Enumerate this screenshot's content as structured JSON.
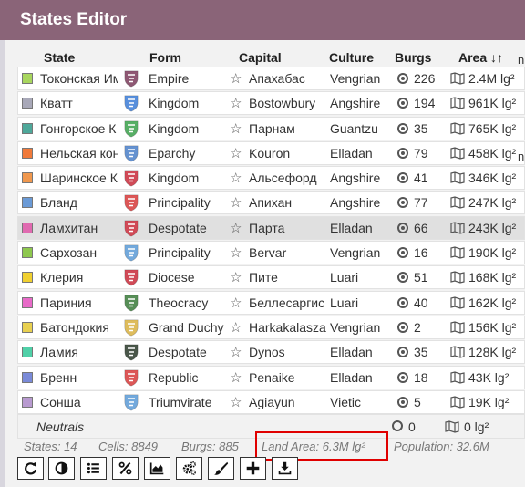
{
  "window": {
    "title": "States Editor"
  },
  "columns": {
    "state": "State",
    "form": "Form",
    "capital": "Capital",
    "culture": "Culture",
    "burgs": "Burgs",
    "area": "Area ↓↑"
  },
  "states": [
    {
      "color": "#a8d65e",
      "name": "Токонская Им",
      "form": "Empire",
      "capital": "Апахабас",
      "culture": "Vengrian",
      "burgs": "226",
      "area": "2.4M lg²",
      "shield_color": "#7a3b5b",
      "highlighted": false
    },
    {
      "color": "#a8a8b8",
      "name": "Кватт",
      "form": "Kingdom",
      "capital": "Bostowbury",
      "culture": "Angshire",
      "burgs": "194",
      "area": "961K lg²",
      "shield_color": "#3b7bd6",
      "highlighted": false
    },
    {
      "color": "#4ea89a",
      "name": "Гонгорское К",
      "form": "Kingdom",
      "capital": "Парнам",
      "culture": "Guantzu",
      "burgs": "35",
      "area": "765K lg²",
      "shield_color": "#3aa04a",
      "highlighted": false
    },
    {
      "color": "#f07a3a",
      "name": "Нельская кон",
      "form": "Eparchy",
      "capital": "Kouron",
      "culture": "Elladan",
      "burgs": "79",
      "area": "458K lg²",
      "shield_color": "#4a7fc8",
      "highlighted": false
    },
    {
      "color": "#f0984e",
      "name": "Шаринское К",
      "form": "Kingdom",
      "capital": "Альсефорд",
      "culture": "Angshire",
      "burgs": "41",
      "area": "346K lg²",
      "shield_color": "#c82a3a",
      "highlighted": false
    },
    {
      "color": "#6a9ad6",
      "name": "Бланд",
      "form": "Principality",
      "capital": "Апихан",
      "culture": "Angshire",
      "burgs": "77",
      "area": "247K lg²",
      "shield_color": "#d63a3a",
      "highlighted": false
    },
    {
      "color": "#e06ab0",
      "name": "Ламхитан",
      "form": "Despotate",
      "capital": "Парта",
      "culture": "Elladan",
      "burgs": "66",
      "area": "243K lg²",
      "shield_color": "#c82a3a",
      "highlighted": true
    },
    {
      "color": "#8ec84e",
      "name": "Сархозан",
      "form": "Principality",
      "capital": "Bervar",
      "culture": "Vengrian",
      "burgs": "16",
      "area": "190K lg²",
      "shield_color": "#5a9ad6",
      "highlighted": false
    },
    {
      "color": "#f0d030",
      "name": "Клерия",
      "form": "Diocese",
      "capital": "Пите",
      "culture": "Luari",
      "burgs": "51",
      "area": "168K lg²",
      "shield_color": "#c82a3a",
      "highlighted": false
    },
    {
      "color": "#e86ac8",
      "name": "Париния",
      "form": "Theocracy",
      "capital": "Беллесаргис",
      "culture": "Luari",
      "burgs": "40",
      "area": "162K lg²",
      "shield_color": "#3a7a3a",
      "highlighted": false
    },
    {
      "color": "#e8d050",
      "name": "Батондокия",
      "form": "Grand Duchy",
      "capital": "Harkakalasza",
      "culture": "Vengrian",
      "burgs": "2",
      "area": "156K lg²",
      "shield_color": "#d8b040",
      "highlighted": false
    },
    {
      "color": "#50d0a8",
      "name": "Ламия",
      "form": "Despotate",
      "capital": "Dynos",
      "culture": "Elladan",
      "burgs": "35",
      "area": "128K lg²",
      "shield_color": "#2a3a2a",
      "highlighted": false
    },
    {
      "color": "#7a8ad8",
      "name": "Бренн",
      "form": "Republic",
      "capital": "Penaike",
      "culture": "Elladan",
      "burgs": "18",
      "area": "43K lg²",
      "shield_color": "#d63a3a",
      "highlighted": false
    },
    {
      "color": "#b89ad0",
      "name": "Сонша",
      "form": "Triumvirate",
      "capital": "Agiayun",
      "culture": "Vietic",
      "burgs": "5",
      "area": "19K lg²",
      "shield_color": "#5a9ad6",
      "highlighted": false
    }
  ],
  "neutrals": {
    "label": "Neutrals",
    "burgs": "0",
    "area": "0 lg²"
  },
  "footer": {
    "states": "States: 14",
    "cells": "Cells: 8849",
    "burgs": "Burgs: 885",
    "land_area": "Land Area: 6.3M lg²",
    "population": "Population: 32.6M"
  },
  "edge_fragments": [
    "n",
    "n"
  ],
  "toolbar": {
    "buttons": [
      {
        "icon": "refresh-icon"
      },
      {
        "icon": "contrast-icon"
      },
      {
        "icon": "list-icon"
      },
      {
        "icon": "percent-icon"
      },
      {
        "icon": "area-chart-icon"
      },
      {
        "icon": "cogs-icon"
      },
      {
        "icon": "brush-icon"
      },
      {
        "icon": "plus-icon"
      },
      {
        "icon": "download-icon"
      }
    ]
  },
  "colors": {
    "titlebar": "#8a6478",
    "highlight_box": "#e00000"
  }
}
